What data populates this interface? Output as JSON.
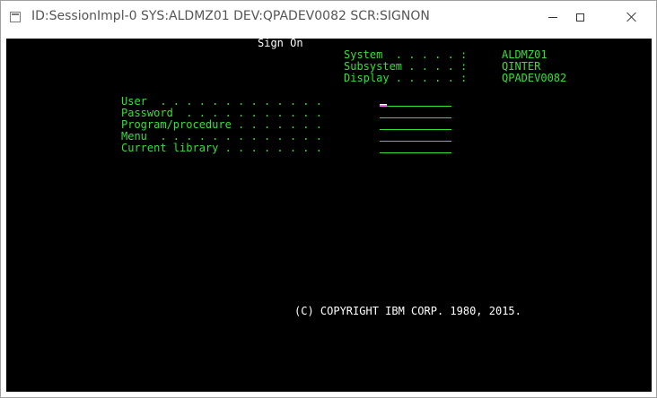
{
  "window": {
    "title": "ID:SessionImpl-0 SYS:ALDMZ01 DEV:QPADEV0082 SCR:SIGNON"
  },
  "screen": {
    "heading": "Sign On",
    "info": [
      {
        "label": "System  . . . . . :",
        "value": "ALDMZ01"
      },
      {
        "label": "Subsystem . . . . :",
        "value": "QINTER"
      },
      {
        "label": "Display . . . . . :",
        "value": "QPADEV0082"
      }
    ],
    "fields": [
      {
        "label": "User  . . . . . . . . . . . . .",
        "value": ""
      },
      {
        "label": "Password  . . . . . . . . . . .",
        "value": ""
      },
      {
        "label": "Program/procedure . . . . . . .",
        "value": ""
      },
      {
        "label": "Menu  . . . . . . . . . . . . .",
        "value": ""
      },
      {
        "label": "Current library . . . . . . . .",
        "value": ""
      }
    ],
    "copyright": "(C) COPYRIGHT IBM CORP. 1980, 2015."
  },
  "colors": {
    "screen_bg": "#000000",
    "text_green": "#36e036",
    "text_white": "#ffffff",
    "cursor": "#ff66ff"
  }
}
